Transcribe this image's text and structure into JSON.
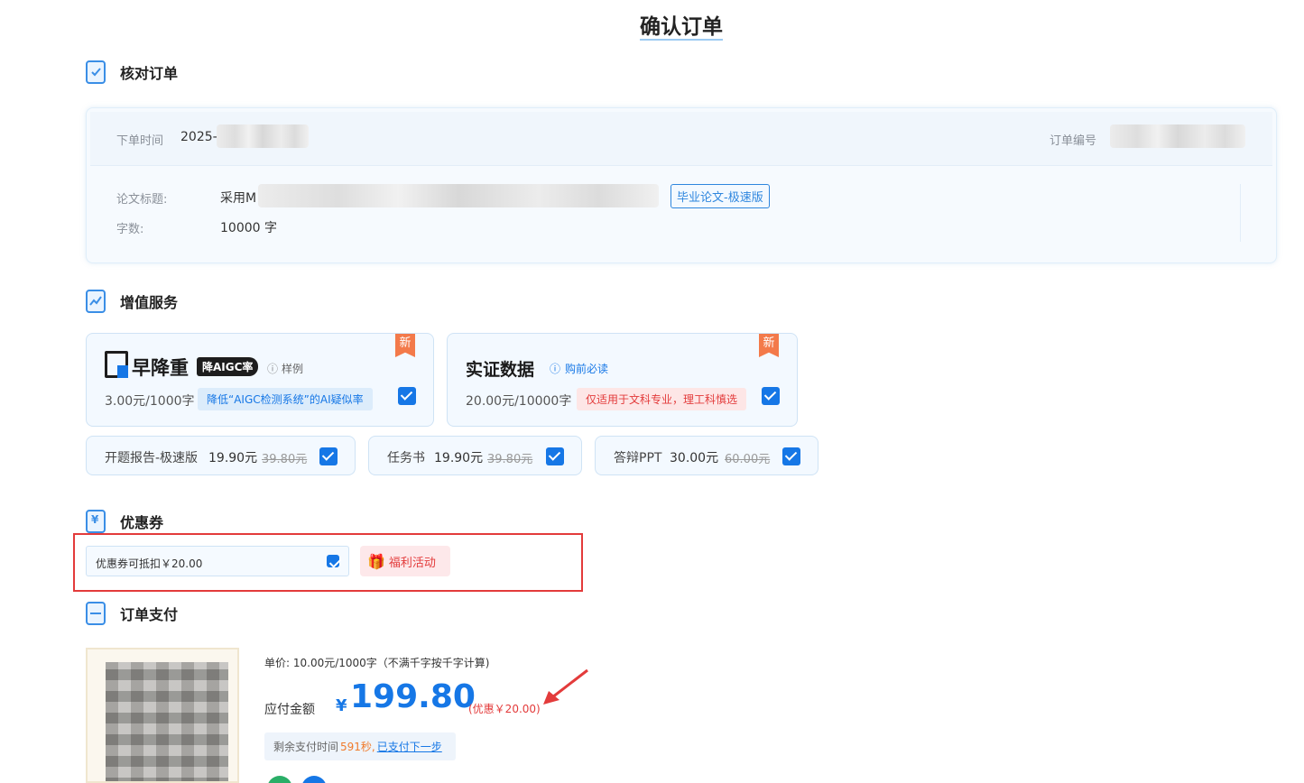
{
  "page": {
    "title": "确认订单"
  },
  "sections": {
    "check_order": "核对订单",
    "value_added": "增值服务",
    "coupon": "优惠券",
    "payment": "订单支付"
  },
  "order": {
    "time_label": "下单时间",
    "time_value": "2025-",
    "number_label": "订单编号",
    "paper_title_label": "论文标题:",
    "paper_title_value": "采用M",
    "paper_type_tag": "毕业论文-极速版",
    "word_count_label": "字数:",
    "word_count_value": "10000 字"
  },
  "services": {
    "aigc": {
      "brand": "早降重",
      "badge": "降AIGC率",
      "sample_link": "样例",
      "new_badge": "新",
      "price": "3.00元/1000字",
      "desc": "降低“AIGC检测系统”的AI疑似率",
      "checked": true
    },
    "data": {
      "title": "实证数据",
      "notice_link": "购前必读",
      "new_badge": "新",
      "price": "20.00元/10000字",
      "warning": "仅适用于文科专业，理工科慎选",
      "checked": true
    },
    "extras": [
      {
        "name": "开题报告-极速版",
        "price": "19.90元",
        "original": "39.80元",
        "checked": true
      },
      {
        "name": "任务书",
        "price": "19.90元",
        "original": "39.80元",
        "checked": true
      },
      {
        "name": "答辩PPT",
        "price": "30.00元",
        "original": "60.00元",
        "checked": true
      }
    ]
  },
  "coupon": {
    "selected": "优惠券可抵扣￥20.00",
    "activity_button": "福利活动"
  },
  "payment": {
    "unit_price": "单价: 10.00元/1000字（不满千字按千字计算)",
    "amount_label": "应付金额",
    "currency": "¥",
    "amount": "199.80",
    "discount": "(优惠￥20.00)",
    "remain_label": "剩余支付时间",
    "remain_value": "591秒,",
    "paid_link": "已支付下一步"
  },
  "colors": {
    "accent": "#1677e6",
    "danger": "#e33b3b",
    "new_badge": "#f37a4a"
  }
}
